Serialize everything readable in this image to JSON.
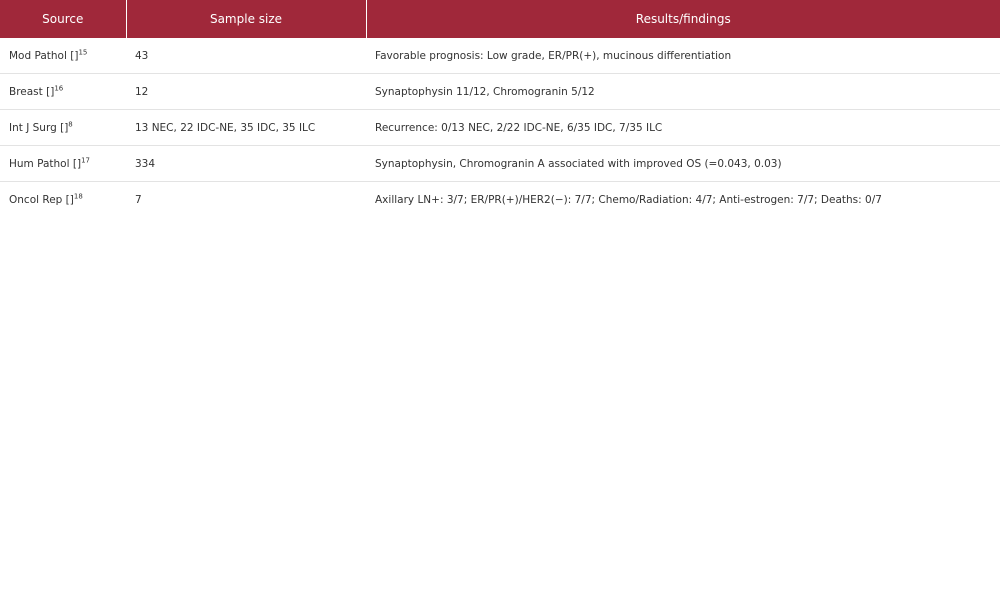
{
  "table": {
    "headers": [
      "Source",
      "Sample size",
      "Results/findings"
    ],
    "rows": [
      {
        "source": "Mod Pathol []",
        "ref": "15",
        "sample": "43",
        "result": "Favorable prognosis: Low grade, ER/PR(+), mucinous differentiation"
      },
      {
        "source": "Breast []",
        "ref": "16",
        "sample": "12",
        "result": "Synaptophysin 11/12, Chromogranin 5/12"
      },
      {
        "source": "Int J Surg []",
        "ref": "8",
        "sample": "13 NEC, 22 IDC-NE, 35 IDC, 35 ILC",
        "result": "Recurrence: 0/13 NEC, 2/22 IDC-NE, 6/35 IDC, 7/35 ILC"
      },
      {
        "source": "Hum Pathol []",
        "ref": "17",
        "sample": "334",
        "result": "Synaptophysin, Chromogranin A associated with improved OS (=0.043, 0.03)"
      },
      {
        "source": "Oncol Rep []",
        "ref": "18",
        "sample": "7",
        "result": "Axillary LN+: 3/7; ER/PR(+)/HER2(−): 7/7; Chemo/Radiation: 4/7; Anti-estrogen: 7/7; Deaths: 0/7"
      }
    ]
  },
  "colors": {
    "header_bg": "#a0283a",
    "header_text": "#ffffff",
    "row_border": "#e3e3e3"
  }
}
